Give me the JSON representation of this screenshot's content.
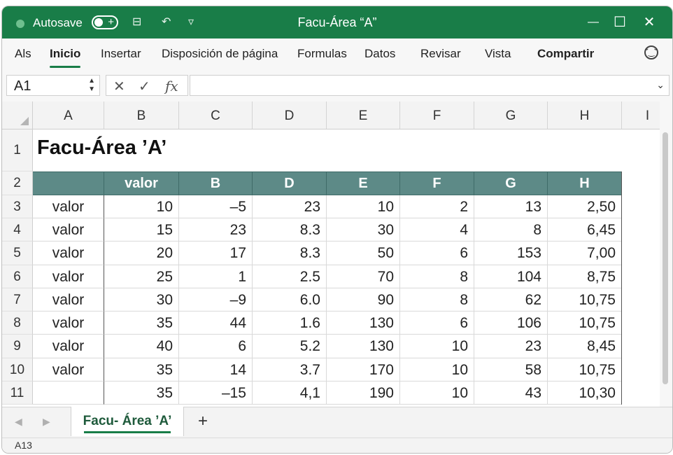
{
  "titlebar": {
    "autosave_label": "Autosave",
    "toggle_plus": "+",
    "title": "Facu-Área “A”",
    "save_icon": "⊟",
    "undo_icon": "↶",
    "more_icon": "▿",
    "minimize": "—",
    "maximize": "☐",
    "close": "✕"
  },
  "ribbon": {
    "tabs": [
      "Als",
      "Inicio",
      "Insertar",
      "Disposición de página",
      "Formulas",
      "Datos",
      "Revisar",
      "Vista",
      "Compartir"
    ],
    "active_tab": "Inicio",
    "feedback_icon": "smiley-icon"
  },
  "formula_bar": {
    "name_box": "A1",
    "cancel": "✕",
    "enter": "✓",
    "fx": "fx",
    "formula": ""
  },
  "grid": {
    "columns": [
      "A",
      "B",
      "C",
      "D",
      "E",
      "F",
      "G",
      "H",
      "I"
    ],
    "rows": [
      "1",
      "2",
      "3",
      "4",
      "5",
      "6",
      "7",
      "8",
      "9",
      "10",
      "11"
    ],
    "title": "Facu-Área ’A’",
    "header_row": [
      "",
      "valor",
      "B",
      "D",
      "E",
      "F",
      "G",
      "H"
    ],
    "data": [
      [
        "valor",
        "10",
        "–5",
        "23",
        "10",
        "2",
        "13",
        "2,50"
      ],
      [
        "valor",
        "15",
        "23",
        "8.3",
        "30",
        "4",
        "8",
        "6,45"
      ],
      [
        "valor",
        "20",
        "17",
        "8.3",
        "50",
        "6",
        "153",
        "7,00"
      ],
      [
        "valor",
        "25",
        "1",
        "2.5",
        "70",
        "8",
        "104",
        "8,75"
      ],
      [
        "valor",
        "30",
        "–9",
        "6.0",
        "90",
        "8",
        "62",
        "10,75"
      ],
      [
        "valor",
        "35",
        "44",
        "1.6",
        "130",
        "6",
        "106",
        "10,75"
      ],
      [
        "valor",
        "40",
        "6",
        "5.2",
        "130",
        "10",
        "23",
        "8,45"
      ],
      [
        "valor",
        "35",
        "14",
        "3.7",
        "170",
        "10",
        "58",
        "10,75"
      ],
      [
        "",
        "35",
        "–15",
        "4,1",
        "190",
        "10",
        "43",
        "10,30"
      ]
    ],
    "header_color": "#5d8a87"
  },
  "sheets": {
    "tabs": [
      "Facu- Área ’A’"
    ],
    "add": "+"
  },
  "status": {
    "cell": "A13"
  },
  "colors": {
    "brand": "#197d48"
  }
}
